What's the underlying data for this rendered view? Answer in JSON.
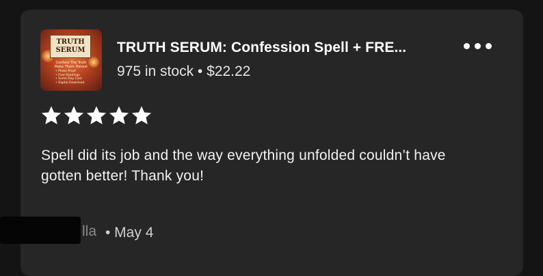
{
  "listing": {
    "title": "TRUTH SERUM: Confession Spell + FRE...",
    "stock_price": "975 in stock • $22.22",
    "thumbnail": {
      "heading_line1": "TRUTH",
      "heading_line2": "SERUM",
      "subtitle_line1": "Confess The Truth",
      "subtitle_line2": "Make Them Honest",
      "bullets": [
        "• Photo Proof",
        "• Free Readings",
        "• Same Day Cast",
        "• Digital Download"
      ]
    }
  },
  "menu": {
    "icon": "more-horizontal-icon"
  },
  "review": {
    "rating": 5,
    "max_rating": 5,
    "text": "Spell did its job and the way everything unfolded couldn’t have gotten better! Thank you!"
  },
  "reviewer": {
    "name_visible": "lla",
    "date": "• May 4"
  },
  "colors": {
    "page_background": "#141414",
    "card_background": "#262626",
    "text_primary": "#ffffff",
    "star": "#ffffff"
  }
}
